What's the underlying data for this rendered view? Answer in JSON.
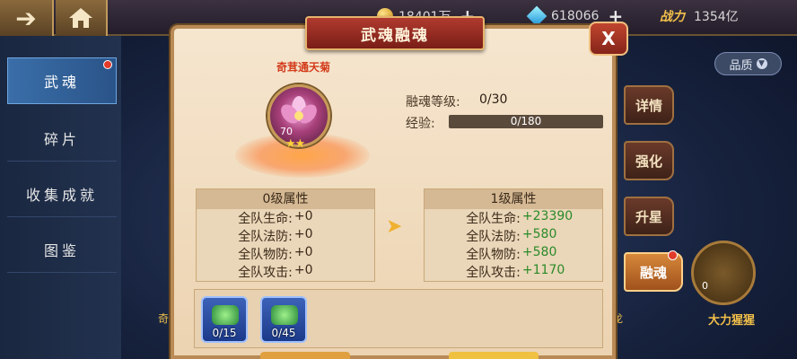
{
  "topbar": {
    "gold": "18401万",
    "gems": "618066",
    "power_label": "战力",
    "power_value": "1354亿"
  },
  "nav": {
    "items": [
      {
        "label": "武魂"
      },
      {
        "label": "碎片"
      },
      {
        "label": "收集成就"
      },
      {
        "label": "图鉴"
      }
    ]
  },
  "filter": {
    "label": "品质"
  },
  "side_buttons": [
    "详情",
    "强化",
    "升星",
    "融魂"
  ],
  "background_cards": {
    "right_name": "大力猩猩",
    "right_level": "0",
    "left_fragment": "奇",
    "right_fragment": "龙"
  },
  "dialog": {
    "title": "武魂融魂",
    "close_label": "X",
    "soul": {
      "name": "奇茸通天菊",
      "level": "70",
      "stars": "★★"
    },
    "info": {
      "fusion_level_label": "融魂等级:",
      "fusion_level_value": "0/30",
      "exp_label": "经验:",
      "exp_value": "0/180",
      "exp_fraction": 0
    },
    "current": {
      "header": "0级属性",
      "rows": [
        {
          "k": "全队生命:",
          "v": "+0"
        },
        {
          "k": "全队法防:",
          "v": "+0"
        },
        {
          "k": "全队物防:",
          "v": "+0"
        },
        {
          "k": "全队攻击:",
          "v": "+0"
        }
      ]
    },
    "next": {
      "header": "1级属性",
      "rows": [
        {
          "k": "全队生命:",
          "v": "+23390"
        },
        {
          "k": "全队法防:",
          "v": "+580"
        },
        {
          "k": "全队物防:",
          "v": "+580"
        },
        {
          "k": "全队攻击:",
          "v": "+1170"
        }
      ]
    },
    "materials": [
      {
        "count": "0/15"
      },
      {
        "count": "0/45"
      }
    ]
  },
  "colors": {
    "accent_gold": "#f2c04a",
    "positive_green": "#2a8a2a",
    "title_red": "#b03a2e"
  }
}
